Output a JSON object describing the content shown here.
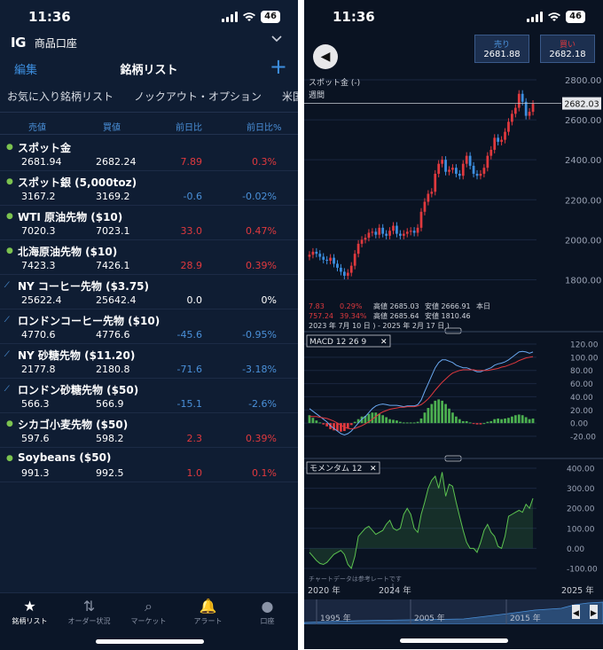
{
  "status_bar": {
    "time": "11:36",
    "battery": "46"
  },
  "account": {
    "logo": "IG",
    "name": "商品口座"
  },
  "header": {
    "edit_label": "編集",
    "title": "銘柄リスト",
    "add_label": "+"
  },
  "tabs": [
    "お気に入り銘柄リスト",
    "ノックアウト・オプション",
    "米国株決"
  ],
  "columns": [
    "売値",
    "買値",
    "前日比",
    "前日比%"
  ],
  "instruments": [
    {
      "name": "スポット金",
      "marker": "dot",
      "sell": "2681.94",
      "buy": "2682.24",
      "change": "7.89",
      "change_pct": "0.3%",
      "dir": "pos"
    },
    {
      "name": "スポット銀 (5,000toz)",
      "marker": "dot",
      "sell": "3167.2",
      "buy": "3169.2",
      "change": "-0.6",
      "change_pct": "-0.02%",
      "dir": "neg"
    },
    {
      "name": "WTI 原油先物 ($10)",
      "marker": "dot",
      "sell": "7020.3",
      "buy": "7023.1",
      "change": "33.0",
      "change_pct": "0.47%",
      "dir": "pos"
    },
    {
      "name": "北海原油先物 ($10)",
      "marker": "dot",
      "sell": "7423.3",
      "buy": "7426.1",
      "change": "28.9",
      "change_pct": "0.39%",
      "dir": "pos"
    },
    {
      "name": "NY コーヒー先物 ($3.75)",
      "marker": "slash",
      "sell": "25622.4",
      "buy": "25642.4",
      "change": "0.0",
      "change_pct": "0%",
      "dir": "zero"
    },
    {
      "name": "ロンドンコーヒー先物 ($10)",
      "marker": "slash",
      "sell": "4770.6",
      "buy": "4776.6",
      "change": "-45.6",
      "change_pct": "-0.95%",
      "dir": "neg"
    },
    {
      "name": "NY 砂糖先物 ($11.20)",
      "marker": "slash",
      "sell": "2177.8",
      "buy": "2180.8",
      "change": "-71.6",
      "change_pct": "-3.18%",
      "dir": "neg"
    },
    {
      "name": "ロンドン砂糖先物 ($50)",
      "marker": "slash",
      "sell": "566.3",
      "buy": "566.9",
      "change": "-15.1",
      "change_pct": "-2.6%",
      "dir": "neg"
    },
    {
      "name": "シカゴ小麦先物 ($50)",
      "marker": "dot",
      "sell": "597.6",
      "buy": "598.2",
      "change": "2.3",
      "change_pct": "0.39%",
      "dir": "pos"
    },
    {
      "name": "Soybeans ($50)",
      "marker": "dot",
      "sell": "991.3",
      "buy": "992.5",
      "change": "1.0",
      "change_pct": "0.1%",
      "dir": "pos"
    }
  ],
  "bottom_nav": [
    {
      "label": "銘柄リスト",
      "icon": "star-icon",
      "glyph": "★",
      "active": true
    },
    {
      "label": "オーダー状況",
      "icon": "arrows-icon",
      "glyph": "⇅",
      "active": false
    },
    {
      "label": "マーケット",
      "icon": "search-icon",
      "glyph": "⌕",
      "active": false
    },
    {
      "label": "アラート",
      "icon": "bell-icon",
      "glyph": "🔔",
      "active": false
    },
    {
      "label": "口座",
      "icon": "user-icon",
      "glyph": "●",
      "active": false
    }
  ],
  "trade_buttons": {
    "sell_label": "売り",
    "sell_price": "2681.88",
    "buy_label": "買い",
    "buy_price": "2682.18"
  },
  "chart_info": {
    "title": "スポット金 (-)",
    "period": "週間",
    "current_price": "2682.03",
    "stats_line1": {
      "change": "7.83",
      "change_pct": "0.29%",
      "high": "高値 2685.03",
      "low": "安値 2666.91",
      "label": "本日"
    },
    "stats_line2": {
      "change": "757.24",
      "change_pct": "39.34%",
      "high": "高値 2685.64",
      "low": "安値 1810.46"
    },
    "date_range": "2023 年 7月 10 日 ) - 2025 年 2月 17 日 )",
    "disclaimer": "チャートデータは参考レートです",
    "macd_label": "MACD  12  26  9",
    "momentum_label": "モメンタム  12",
    "close_glyph": "✕",
    "x_ticks": [
      "2020 年",
      "2024 年",
      "2025 年"
    ],
    "navigator_ticks": [
      "1995 年",
      "2005 年",
      "2015 年"
    ]
  },
  "chart_data": [
    {
      "type": "candlestick",
      "title": "スポット金 (-)",
      "ylim": [
        1700,
        2800
      ],
      "yticks": [
        "2800.00",
        "2600.00",
        "2400.00",
        "2200.00",
        "2000.00",
        "1800.00"
      ],
      "last_value": 2682.03,
      "values": [
        1925,
        1940,
        1930,
        1915,
        1900,
        1895,
        1910,
        1880,
        1860,
        1840,
        1820,
        1835,
        1870,
        1930,
        1980,
        2000,
        2010,
        2035,
        2040,
        2025,
        2060,
        2030,
        2020,
        2045,
        2070,
        2030,
        2020,
        2030,
        2040,
        2045,
        2035,
        2060,
        2140,
        2190,
        2230,
        2240,
        2330,
        2380,
        2400,
        2340,
        2350,
        2360,
        2330,
        2320,
        2380,
        2420,
        2370,
        2330,
        2320,
        2330,
        2360,
        2420,
        2450,
        2510,
        2490,
        2500,
        2540,
        2590,
        2630,
        2660,
        2730,
        2690,
        2620,
        2640,
        2680
      ]
    },
    {
      "type": "line",
      "title": "MACD  12  26  9",
      "ylim": [
        -20,
        120
      ],
      "yticks": [
        "120.00",
        "100.00",
        "80.00",
        "60.00",
        "40.00",
        "20.00",
        "0.00",
        "-20.00"
      ],
      "series": [
        {
          "name": "MACD",
          "values": [
            22,
            18,
            14,
            10,
            6,
            2,
            -4,
            -8,
            -12,
            -16,
            -18,
            -16,
            -12,
            -6,
            0,
            6,
            10,
            16,
            22,
            26,
            28,
            29,
            28,
            27,
            27,
            27,
            26,
            25,
            26,
            26,
            26,
            28,
            35,
            48,
            60,
            72,
            84,
            92,
            96,
            96,
            94,
            92,
            88,
            86,
            84,
            84,
            82,
            80,
            78,
            78,
            80,
            82,
            84,
            88,
            90,
            91,
            93,
            96,
            100,
            104,
            108,
            109,
            108,
            106,
            108
          ]
        },
        {
          "name": "Signal",
          "values": [
            10,
            10,
            10,
            9,
            8,
            7,
            5,
            3,
            0,
            -3,
            -6,
            -8,
            -9,
            -8,
            -6,
            -4,
            -1,
            2,
            6,
            10,
            14,
            17,
            19,
            21,
            22,
            23,
            24,
            24,
            25,
            25,
            25,
            26,
            28,
            32,
            37,
            43,
            50,
            56,
            62,
            67,
            72,
            76,
            78,
            80,
            81,
            81,
            81,
            81,
            80,
            80,
            80,
            80,
            81,
            82,
            83,
            85,
            86,
            88,
            90,
            92,
            95,
            97,
            99,
            100,
            101
          ]
        }
      ],
      "histogram": [
        12,
        8,
        4,
        1,
        -2,
        -5,
        -9,
        -11,
        -12,
        -13,
        -12,
        -8,
        -3,
        2,
        6,
        10,
        11,
        14,
        16,
        16,
        14,
        12,
        9,
        6,
        5,
        4,
        2,
        1,
        1,
        1,
        1,
        2,
        7,
        16,
        23,
        29,
        34,
        36,
        34,
        29,
        22,
        16,
        10,
        6,
        3,
        3,
        1,
        -1,
        -2,
        -2,
        0,
        2,
        3,
        6,
        7,
        6,
        7,
        8,
        10,
        12,
        13,
        12,
        9,
        6,
        7
      ]
    },
    {
      "type": "area",
      "title": "モメンタム  12",
      "ylim": [
        -100,
        400
      ],
      "yticks": [
        "400.00",
        "300.00",
        "200.00",
        "100.00",
        "0.00",
        "-100.00"
      ],
      "series": [
        {
          "name": "モメンタム",
          "values": [
            -20,
            -40,
            -60,
            -75,
            -80,
            -70,
            -50,
            -30,
            -20,
            -10,
            -30,
            -80,
            -100,
            -40,
            60,
            80,
            100,
            110,
            90,
            70,
            80,
            90,
            120,
            140,
            100,
            90,
            100,
            170,
            200,
            170,
            100,
            80,
            170,
            230,
            300,
            340,
            360,
            300,
            380,
            260,
            320,
            310,
            230,
            160,
            90,
            30,
            0,
            0,
            -20,
            30,
            90,
            120,
            80,
            60,
            10,
            0,
            60,
            160,
            170,
            180,
            190,
            180,
            220,
            200,
            250
          ]
        }
      ]
    }
  ]
}
